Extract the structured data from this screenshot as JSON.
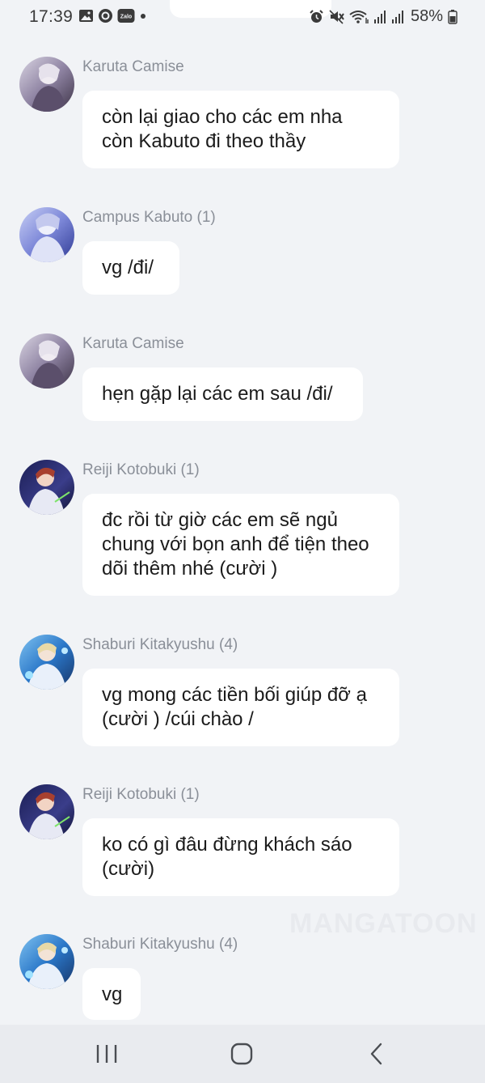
{
  "status_bar": {
    "time": "17:39",
    "battery": "58%",
    "left_icons": [
      "image-icon",
      "circle-app-icon",
      "zalo-icon",
      "dot-icon"
    ],
    "right_icons": [
      "alarm-icon",
      "mute-icon",
      "wifi-icon",
      "signal-icon",
      "signal-icon-2",
      "battery-icon"
    ],
    "zalo_label": "Zalo"
  },
  "messages": [
    {
      "sender": "Karuta Camise",
      "text": "còn lại giao cho các em nha\ncòn  Kabuto đi theo thầy",
      "avatar_palette": [
        "#c9c3d3",
        "#5a4e66"
      ]
    },
    {
      "sender": "Campus Kabuto (1)",
      "text": "vg /đi/",
      "avatar_palette": [
        "#9aa6e3",
        "#3e4aa8"
      ]
    },
    {
      "sender": "Karuta Camise",
      "text": "hẹn gặp lại các em sau /đi/",
      "avatar_palette": [
        "#c9c3d3",
        "#5a4e66"
      ]
    },
    {
      "sender": "Reiji Kotobuki (1)",
      "text": "đc rồi từ giờ các em sẽ ngủ\nchung với bọn anh để tiện theo\ndõi thêm nhé (cười )",
      "avatar_palette": [
        "#2b2d6e",
        "#b14a3a"
      ]
    },
    {
      "sender": "Shaburi Kitakyushu (4)",
      "text": "vg mong các tiền bối giúp đỡ ạ\n(cười ) /cúi chào /",
      "avatar_palette": [
        "#3f8ed6",
        "#1d3b7a"
      ]
    },
    {
      "sender": "Reiji Kotobuki (1)",
      "text": "ko có gì đâu đừng khách sáo\n(cười)",
      "avatar_palette": [
        "#2b2d6e",
        "#b14a3a"
      ]
    },
    {
      "sender": "Shaburi Kitakyushu (4)",
      "text": "vg",
      "avatar_palette": [
        "#3f8ed6",
        "#1d3b7a"
      ]
    }
  ],
  "watermark": "MANGATOON",
  "nav": {
    "buttons": [
      "recent-apps-icon",
      "home-icon",
      "back-icon"
    ]
  }
}
